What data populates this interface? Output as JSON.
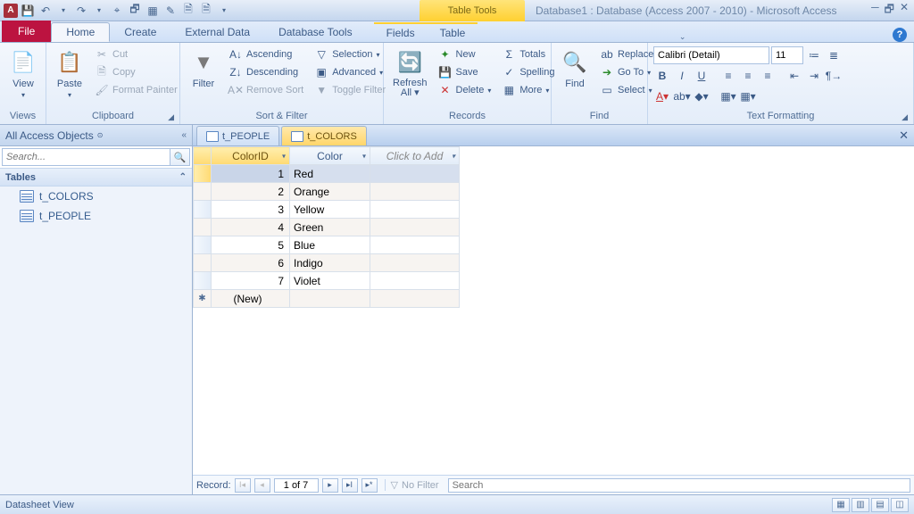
{
  "title": "Database1 : Database (Access 2007 - 2010) - Microsoft Access",
  "tabletools": "Table Tools",
  "tabs": {
    "file": "File",
    "home": "Home",
    "create": "Create",
    "external": "External Data",
    "dbtools": "Database Tools",
    "fields": "Fields",
    "table": "Table"
  },
  "ribbon": {
    "views": {
      "label": "Views",
      "view": "View"
    },
    "clipboard": {
      "label": "Clipboard",
      "paste": "Paste",
      "cut": "Cut",
      "copy": "Copy",
      "fmt": "Format Painter"
    },
    "sortfilter": {
      "label": "Sort & Filter",
      "filter": "Filter",
      "asc": "Ascending",
      "desc": "Descending",
      "remove": "Remove Sort",
      "selection": "Selection",
      "advanced": "Advanced",
      "toggle": "Toggle Filter"
    },
    "records": {
      "label": "Records",
      "refresh": "Refresh\nAll",
      "new": "New",
      "save": "Save",
      "delete": "Delete",
      "totals": "Totals",
      "spelling": "Spelling",
      "more": "More"
    },
    "find": {
      "label": "Find",
      "find": "Find",
      "replace": "Replace",
      "goto": "Go To",
      "select": "Select"
    },
    "text": {
      "label": "Text Formatting",
      "font": "Calibri (Detail)",
      "size": "11"
    }
  },
  "nav": {
    "title": "All Access Objects",
    "search": "Search...",
    "cat": "Tables",
    "items": [
      "t_COLORS",
      "t_PEOPLE"
    ]
  },
  "dstabs": [
    "t_PEOPLE",
    "t_COLORS"
  ],
  "columns": {
    "id": "ColorID",
    "color": "Color",
    "add": "Click to Add"
  },
  "rows": [
    {
      "id": "1",
      "v": "Red"
    },
    {
      "id": "2",
      "v": "Orange"
    },
    {
      "id": "3",
      "v": "Yellow"
    },
    {
      "id": "4",
      "v": "Green"
    },
    {
      "id": "5",
      "v": "Blue"
    },
    {
      "id": "6",
      "v": "Indigo"
    },
    {
      "id": "7",
      "v": "Violet"
    }
  ],
  "newrow": "(New)",
  "recnav": {
    "label": "Record:",
    "pos": "1 of 7",
    "nofilter": "No Filter",
    "search": "Search"
  },
  "status": "Datasheet View"
}
